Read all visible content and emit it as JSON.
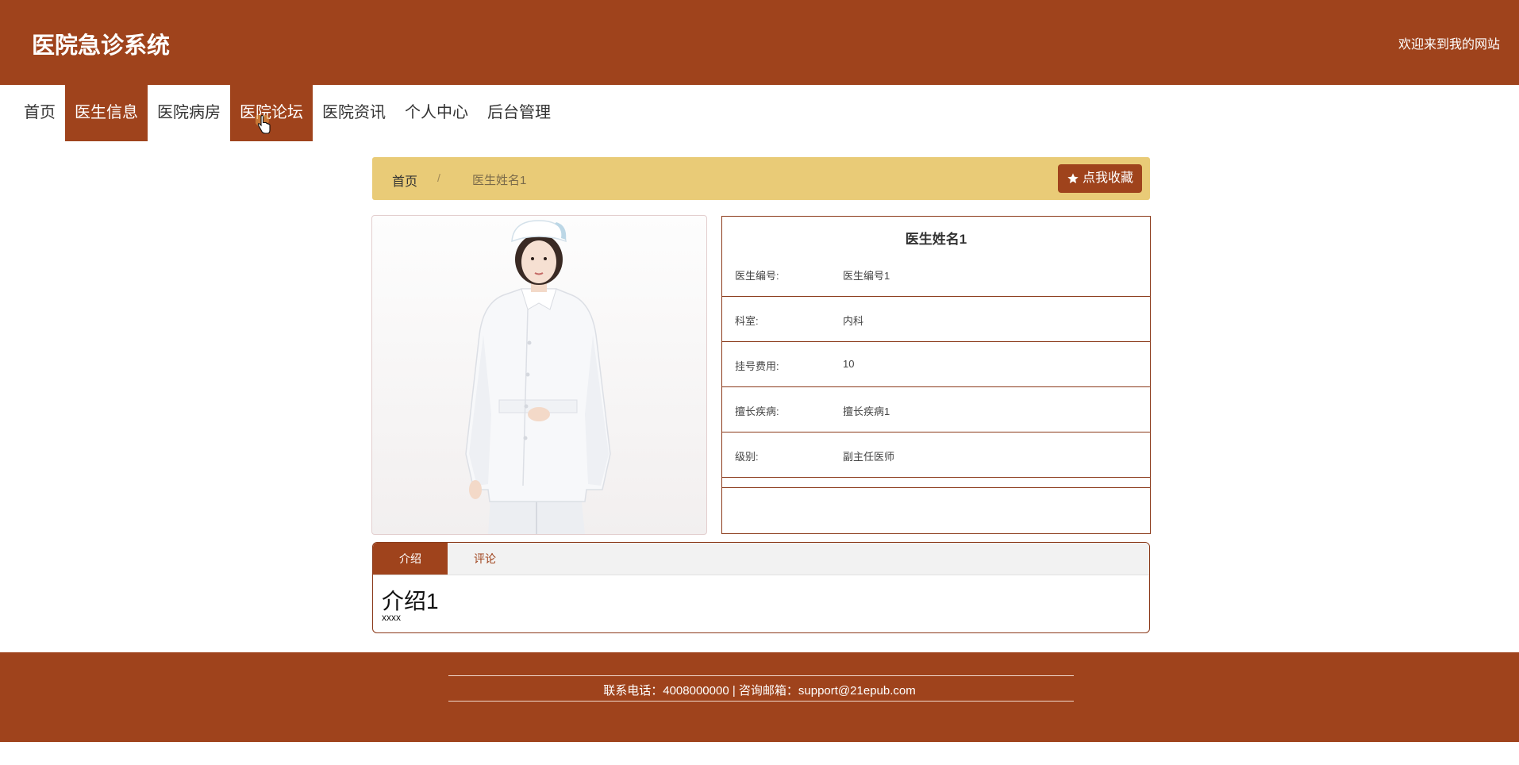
{
  "header": {
    "site_title": "医院急诊系统",
    "welcome_text": "欢迎来到我的网站"
  },
  "nav": {
    "items": [
      {
        "label": "首页",
        "active": false
      },
      {
        "label": "医生信息",
        "active": true
      },
      {
        "label": "医院病房",
        "active": false
      },
      {
        "label": "医院论坛",
        "active": true
      },
      {
        "label": "医院资讯",
        "active": false
      },
      {
        "label": "个人中心",
        "active": false
      },
      {
        "label": "后台管理",
        "active": false
      }
    ]
  },
  "breadcrumb": {
    "home": "首页",
    "separator": "/",
    "current": "医生姓名1"
  },
  "favorite_button": {
    "label": "点我收藏",
    "icon": "star-icon"
  },
  "doctor": {
    "name": "医生姓名1",
    "fields": [
      {
        "label": "医生编号:",
        "value": "医生编号1"
      },
      {
        "label": "科室:",
        "value": "内科"
      },
      {
        "label": "挂号费用:",
        "value": "10"
      },
      {
        "label": "擅长疾病:",
        "value": "擅长疾病1"
      },
      {
        "label": "级别:",
        "value": "副主任医师"
      }
    ]
  },
  "tabs": {
    "items": [
      {
        "label": "介绍",
        "active": true
      },
      {
        "label": "评论",
        "active": false
      }
    ],
    "intro_title": "介绍1",
    "intro_text": "xxxx"
  },
  "footer": {
    "contact_text": "联系电话：4008000000 | 咨询邮箱：support@21epub.com"
  },
  "colors": {
    "brand": "#9f431c",
    "breadcrumb_bg": "#e9cb77"
  }
}
